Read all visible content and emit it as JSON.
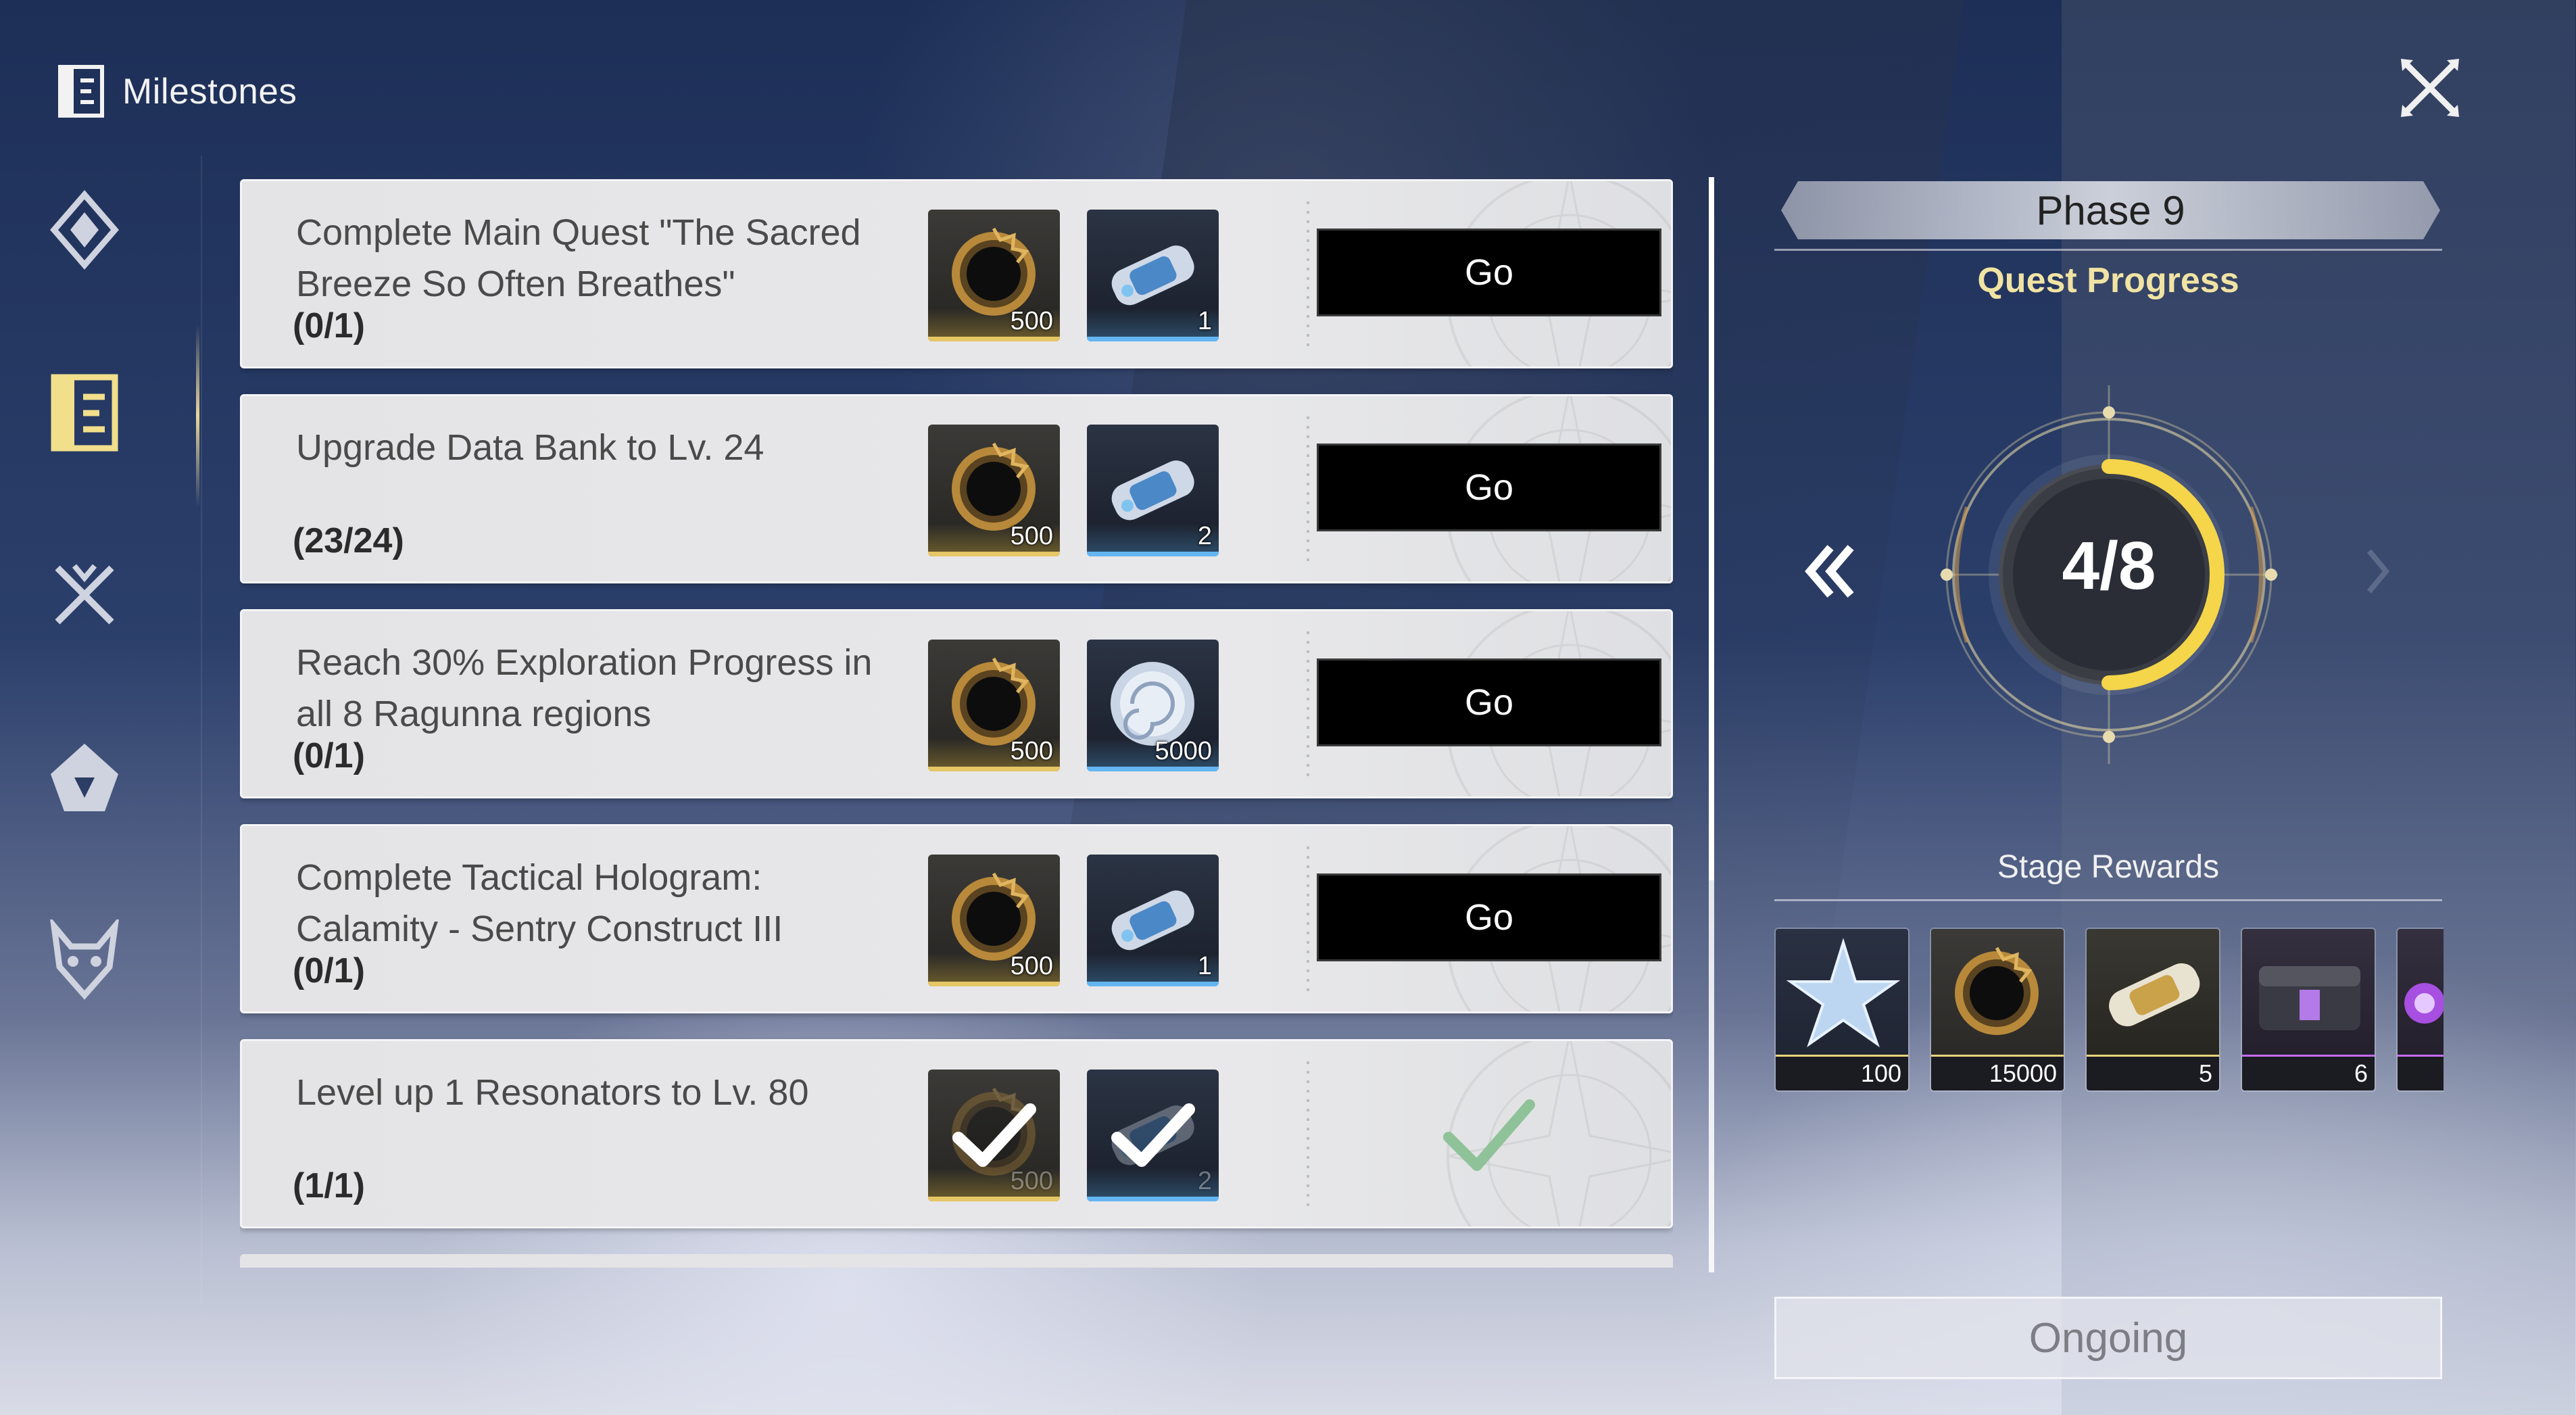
{
  "header": {
    "title": "Milestones"
  },
  "nav": {
    "items": [
      {
        "name": "diamond-emblem-icon",
        "active": false
      },
      {
        "name": "milestones-icon",
        "active": true
      },
      {
        "name": "crossed-swords-icon",
        "active": false
      },
      {
        "name": "flame-emblem-icon",
        "active": false
      },
      {
        "name": "demon-mask-icon",
        "active": false
      }
    ]
  },
  "quests": [
    {
      "title": "Complete Main Quest \"The Sacred Breeze So Often Breathes\"",
      "progress": "(0/1)",
      "rewards": [
        {
          "icon": "shell-credit-icon",
          "count": "500"
        },
        {
          "icon": "energy-capsule-icon",
          "count": "1"
        }
      ],
      "status": "go",
      "action_label": "Go"
    },
    {
      "title": "Upgrade Data Bank to Lv. 24",
      "progress": "(23/24)",
      "rewards": [
        {
          "icon": "shell-credit-icon",
          "count": "500"
        },
        {
          "icon": "energy-capsule-icon",
          "count": "2"
        }
      ],
      "status": "go",
      "action_label": "Go"
    },
    {
      "title": "Reach 30% Exploration Progress in all 8 Ragunna regions",
      "progress": "(0/1)",
      "rewards": [
        {
          "icon": "shell-credit-icon",
          "count": "500"
        },
        {
          "icon": "silver-shell-coin-icon",
          "count": "5000"
        }
      ],
      "status": "go",
      "action_label": "Go"
    },
    {
      "title": "Complete Tactical Hologram: Calamity - Sentry Construct III",
      "progress": "(0/1)",
      "rewards": [
        {
          "icon": "shell-credit-icon",
          "count": "500"
        },
        {
          "icon": "energy-capsule-icon",
          "count": "1"
        }
      ],
      "status": "go",
      "action_label": "Go"
    },
    {
      "title": "Level up 1 Resonators to Lv. 80",
      "progress": "(1/1)",
      "rewards": [
        {
          "icon": "shell-credit-icon",
          "count": "500"
        },
        {
          "icon": "energy-capsule-icon",
          "count": "2"
        }
      ],
      "status": "completed",
      "action_label": ""
    }
  ],
  "phase": {
    "title": "Phase 9",
    "progress_label": "Quest Progress",
    "progress_text": "4/8",
    "progress_fraction": 0.5
  },
  "stage_rewards": {
    "label": "Stage Rewards",
    "items": [
      {
        "icon": "star-crystal-icon",
        "count": "100",
        "rarity_color": "#e8d37a"
      },
      {
        "icon": "shell-credit-icon",
        "count": "15000",
        "rarity_color": "#e8d37a"
      },
      {
        "icon": "gold-capsule-icon",
        "count": "5",
        "rarity_color": "#e8d37a"
      },
      {
        "icon": "supply-chest-icon",
        "count": "6",
        "rarity_color": "#c46cf0"
      },
      {
        "icon": "purple-item-icon",
        "count": "",
        "rarity_color": "#c46cf0"
      }
    ]
  },
  "footer": {
    "button_label": "Ongoing"
  },
  "colors": {
    "gold_accent": "#f5d54a",
    "go_button": "#000000",
    "card_bg": "#e6e6e8"
  }
}
